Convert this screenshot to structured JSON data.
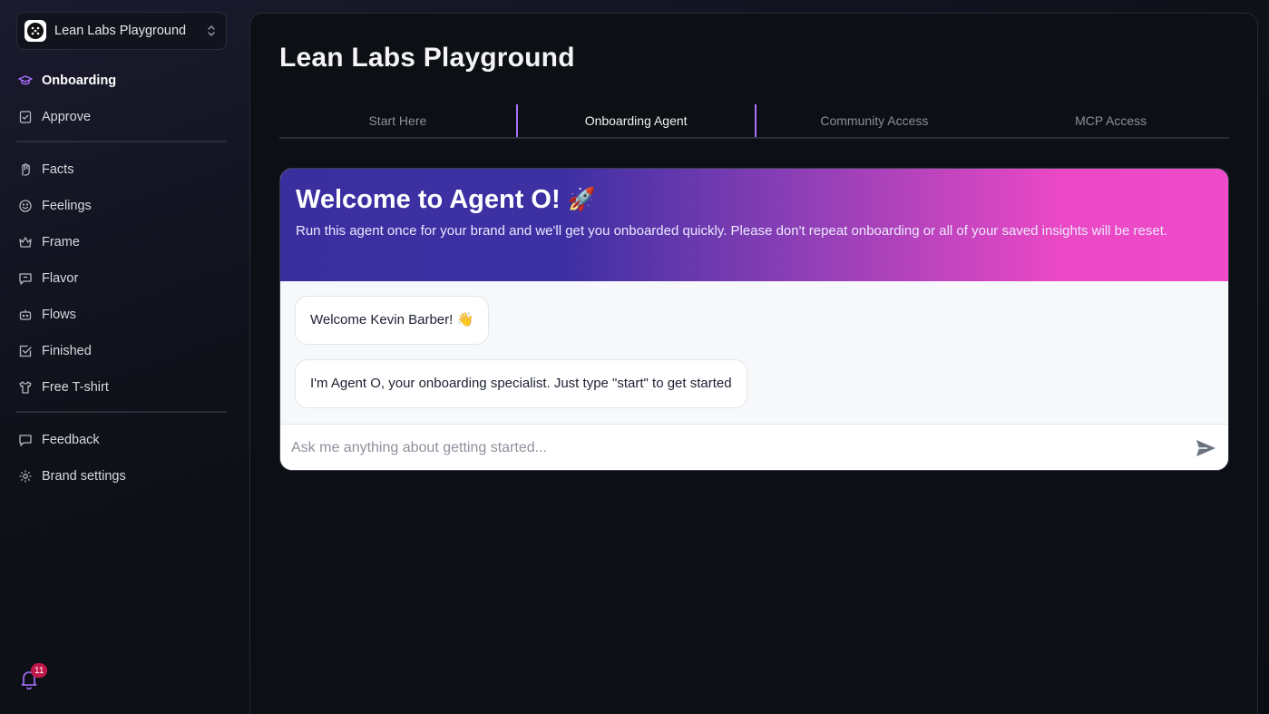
{
  "workspace": {
    "name": "Lean Labs Playground"
  },
  "nav": {
    "group1": [
      {
        "label": "Onboarding",
        "icon": "graduation-cap-icon",
        "active": true
      },
      {
        "label": "Approve",
        "icon": "clipboard-check-icon"
      }
    ],
    "group2": [
      {
        "label": "Facts",
        "icon": "hand-grab-icon"
      },
      {
        "label": "Feelings",
        "icon": "smile-icon"
      },
      {
        "label": "Frame",
        "icon": "crown-icon"
      },
      {
        "label": "Flavor",
        "icon": "message-square-icon"
      },
      {
        "label": "Flows",
        "icon": "bot-icon"
      },
      {
        "label": "Finished",
        "icon": "check-square-icon"
      },
      {
        "label": "Free T-shirt",
        "icon": "shirt-icon"
      }
    ],
    "group3": [
      {
        "label": "Feedback",
        "icon": "message-icon"
      },
      {
        "label": "Brand settings",
        "icon": "gear-icon"
      }
    ]
  },
  "notifications": {
    "count": "11"
  },
  "main": {
    "title": "Lean Labs Playground",
    "tabs": [
      {
        "label": "Start Here"
      },
      {
        "label": "Onboarding Agent",
        "active": true
      },
      {
        "label": "Community Access"
      },
      {
        "label": "MCP Access"
      }
    ]
  },
  "chat": {
    "hero_title": "Welcome to Agent O!",
    "hero_emoji": "🚀",
    "hero_subtitle": "Run this agent once for your brand and we'll get you onboarded quickly. Please don't repeat onboarding or all of your saved insights will be reset.",
    "messages": [
      {
        "text": "Welcome Kevin Barber! 👋"
      },
      {
        "text": "I'm Agent O, your onboarding specialist. Just type \"start\" to get started"
      }
    ],
    "input_placeholder": "Ask me anything about getting started..."
  },
  "colors": {
    "accent": "#a970ff",
    "hero_start": "#3b2fa0",
    "hero_end": "#ef4ac9",
    "badge": "#c0174a"
  }
}
